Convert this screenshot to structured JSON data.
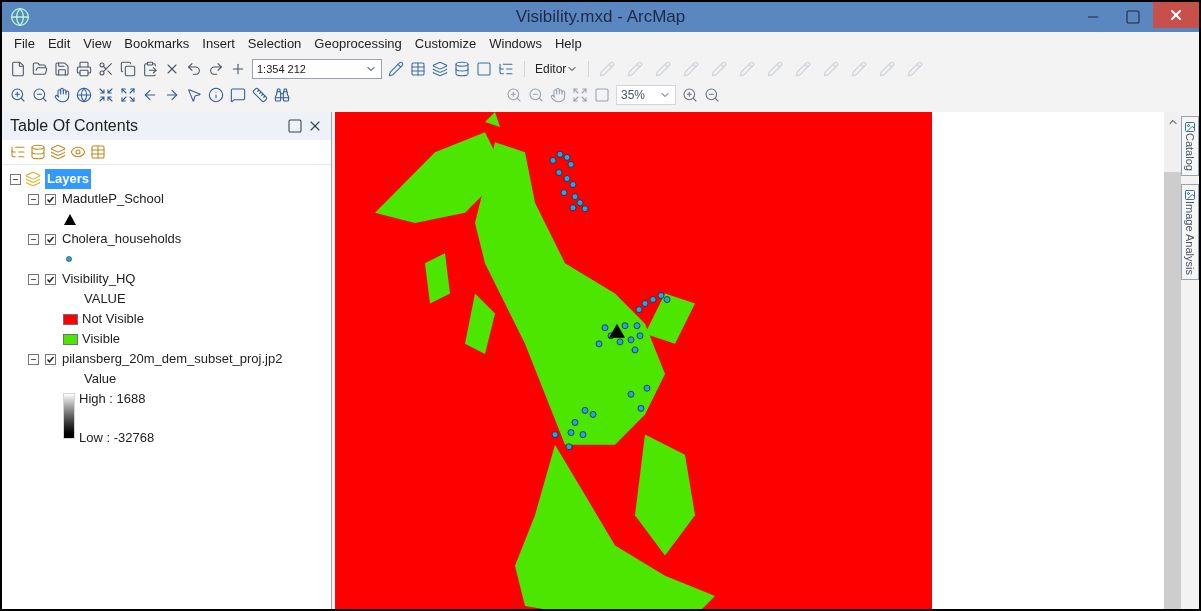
{
  "window": {
    "title": "Visibility.mxd - ArcMap"
  },
  "menu": [
    "File",
    "Edit",
    "View",
    "Bookmarks",
    "Insert",
    "Selection",
    "Geoprocessing",
    "Customize",
    "Windows",
    "Help"
  ],
  "toolbar": {
    "scale": "1:354 212",
    "editor": "Editor",
    "zoom_percent": "35%"
  },
  "toc": {
    "title": "Table Of Contents",
    "tree": {
      "label": "Layers",
      "selected": true,
      "expanded": true,
      "children": [
        {
          "label": "MadutleP_School",
          "checked": true,
          "expanded": true,
          "legend": [
            {
              "kind": "triangle"
            }
          ]
        },
        {
          "label": "Cholera_households",
          "checked": true,
          "expanded": true,
          "legend": [
            {
              "kind": "dot"
            }
          ]
        },
        {
          "label": "Visibility_HQ",
          "checked": true,
          "expanded": true,
          "legend": [
            {
              "kind": "heading",
              "text": "VALUE"
            },
            {
              "kind": "swatch",
              "text": "Not Visible",
              "color": "#ff0000"
            },
            {
              "kind": "swatch",
              "text": "Visible",
              "color": "#4ce600"
            }
          ]
        },
        {
          "label": "pilansberg_20m_dem_subset_proj.jp2",
          "checked": true,
          "expanded": true,
          "legend": [
            {
              "kind": "heading",
              "text": "Value"
            },
            {
              "kind": "ramp",
              "high": "High : 1688",
              "low": "Low : -32768"
            }
          ]
        }
      ]
    }
  },
  "side_tabs": [
    "Catalog",
    "Image Analysis"
  ]
}
